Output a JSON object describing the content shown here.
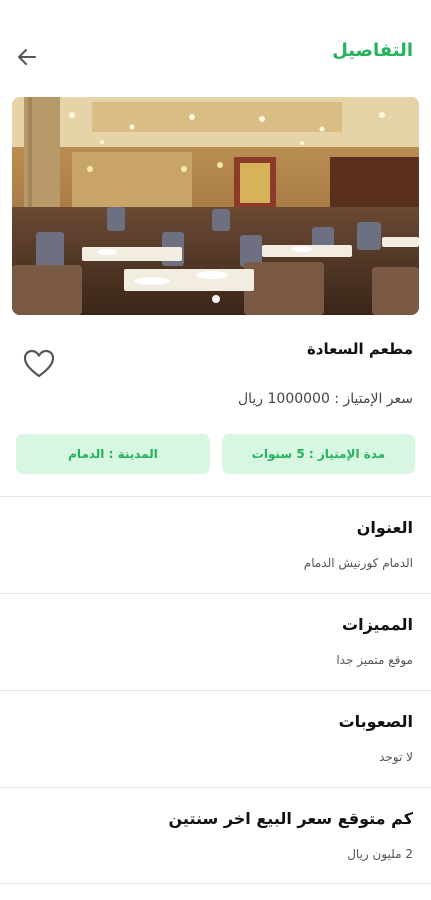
{
  "header": {
    "title": "التفاصيل",
    "back_icon": "arrow-left-icon"
  },
  "gallery": {
    "image_description_icon": "restaurant-photo",
    "page_count": 1,
    "active_index": 0
  },
  "listing": {
    "name": "مطعم السعادة",
    "price_text": "سعر الإمتياز : 1000000 ريال",
    "favorite_icon": "heart-outline-icon"
  },
  "chips": {
    "duration": "مدة الإمتياز : 5 سنوات",
    "city": "المدينة : الدمام"
  },
  "sections": [
    {
      "title": "العنوان",
      "value": "الدمام كورنيش الدمام"
    },
    {
      "title": "المميزات",
      "value": "موقع متميز جدا"
    },
    {
      "title": "الصعوبات",
      "value": "لا توجد"
    },
    {
      "title": "كم متوقع سعر البيع اخر سنتين",
      "value": "2 مليون ريال"
    }
  ],
  "colors": {
    "accent": "#22b35b",
    "chip_bg": "#d7f7e2"
  }
}
